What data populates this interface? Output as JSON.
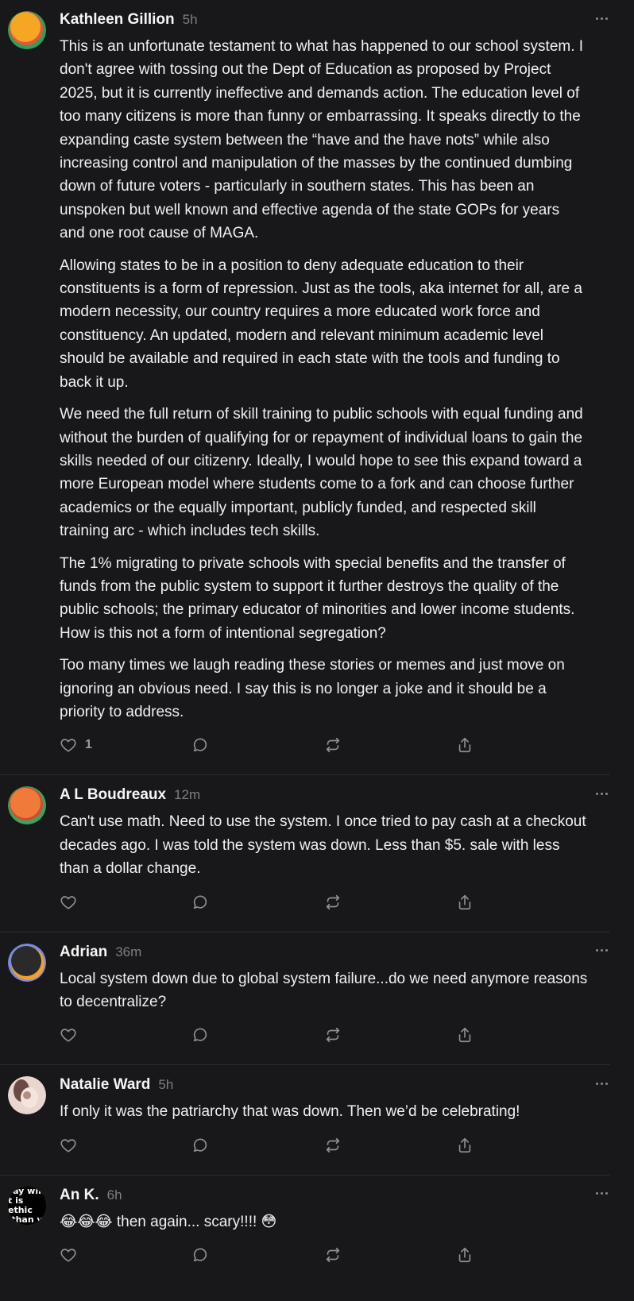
{
  "posts": [
    {
      "author": "Kathleen Gillion",
      "time": "5h",
      "avatar": {
        "colors": [
          "#f5a623",
          "#e8553a",
          "#2e9e5b"
        ]
      },
      "paragraphs": [
        "This is an unfortunate testament to what has happened to our school system. I don't agree with tossing out the Dept of Education as proposed by Project 2025, but it is currently ineffective and demands action. The education level of too many citizens is more than funny or embarrassing. It speaks directly to the expanding caste system between the “have and the have nots” while also increasing control and manipulation of the masses by the continued dumbing down of future voters - particularly in southern states. This has been an unspoken but well known and effective agenda of the state GOPs for years and one root cause of MAGA.",
        "Allowing states to be in a position to deny adequate education to their constituents is a form of repression. Just as the tools, aka internet for all, are a modern necessity, our country requires a more educated work force and constituency. An updated, modern and relevant minimum academic level should be available and required in each state with the tools and funding to back it up.",
        "We need the full return of skill training to public schools with equal funding and without the burden of qualifying for or repayment of individual loans to gain the skills needed of our citizenry. Ideally, I would hope to see this expand toward a more European model where students come to a fork and can choose further academics or the equally important, publicly funded, and respected skill training arc - which includes tech skills.",
        "The 1% migrating to private schools with special benefits and the transfer of funds from the public system to support it further destroys the quality of the public schools; the primary educator of minorities and lower income students. How is this not a form of intentional segregation?",
        "Too many times we laugh reading these stories or memes and just move on ignoring an obvious need. I say this is no longer a joke and it should be a priority to address."
      ],
      "likes": "1"
    },
    {
      "author": "A L Boudreaux",
      "time": "12m",
      "avatar": {
        "colors": [
          "#f07a3a",
          "#d9482b",
          "#3aa35f"
        ]
      },
      "paragraphs": [
        "Can't use math. Need to use the system. I once tried to pay cash at a checkout decades ago. I was told the system was down. Less than $5. sale with less than a dollar change."
      ],
      "likes": ""
    },
    {
      "author": "Adrian",
      "time": "36m",
      "avatar": {
        "colors": [
          "#2a2a2a",
          "#f0a030",
          "#7b8bd6"
        ]
      },
      "paragraphs": [
        "Local system down due to global system failure...do we need anymore reasons to decentralize?"
      ],
      "likes": ""
    },
    {
      "author": "Natalie Ward",
      "time": "5h",
      "avatar": {
        "colors": [
          "#e9d6cf",
          "#b08f85",
          "#6b4a43"
        ]
      },
      "paragraphs": [
        "If only it was the patriarchy that was down. Then we’d be celebrating!"
      ],
      "likes": ""
    },
    {
      "author": "An K.",
      "time": "6h",
      "avatar": {
        "text": [
          "ay wil",
          "t is ethic",
          "than v"
        ]
      },
      "paragraphs": [
        "😂😂😂 then again... scary!!!! 😳"
      ],
      "likes": ""
    }
  ]
}
